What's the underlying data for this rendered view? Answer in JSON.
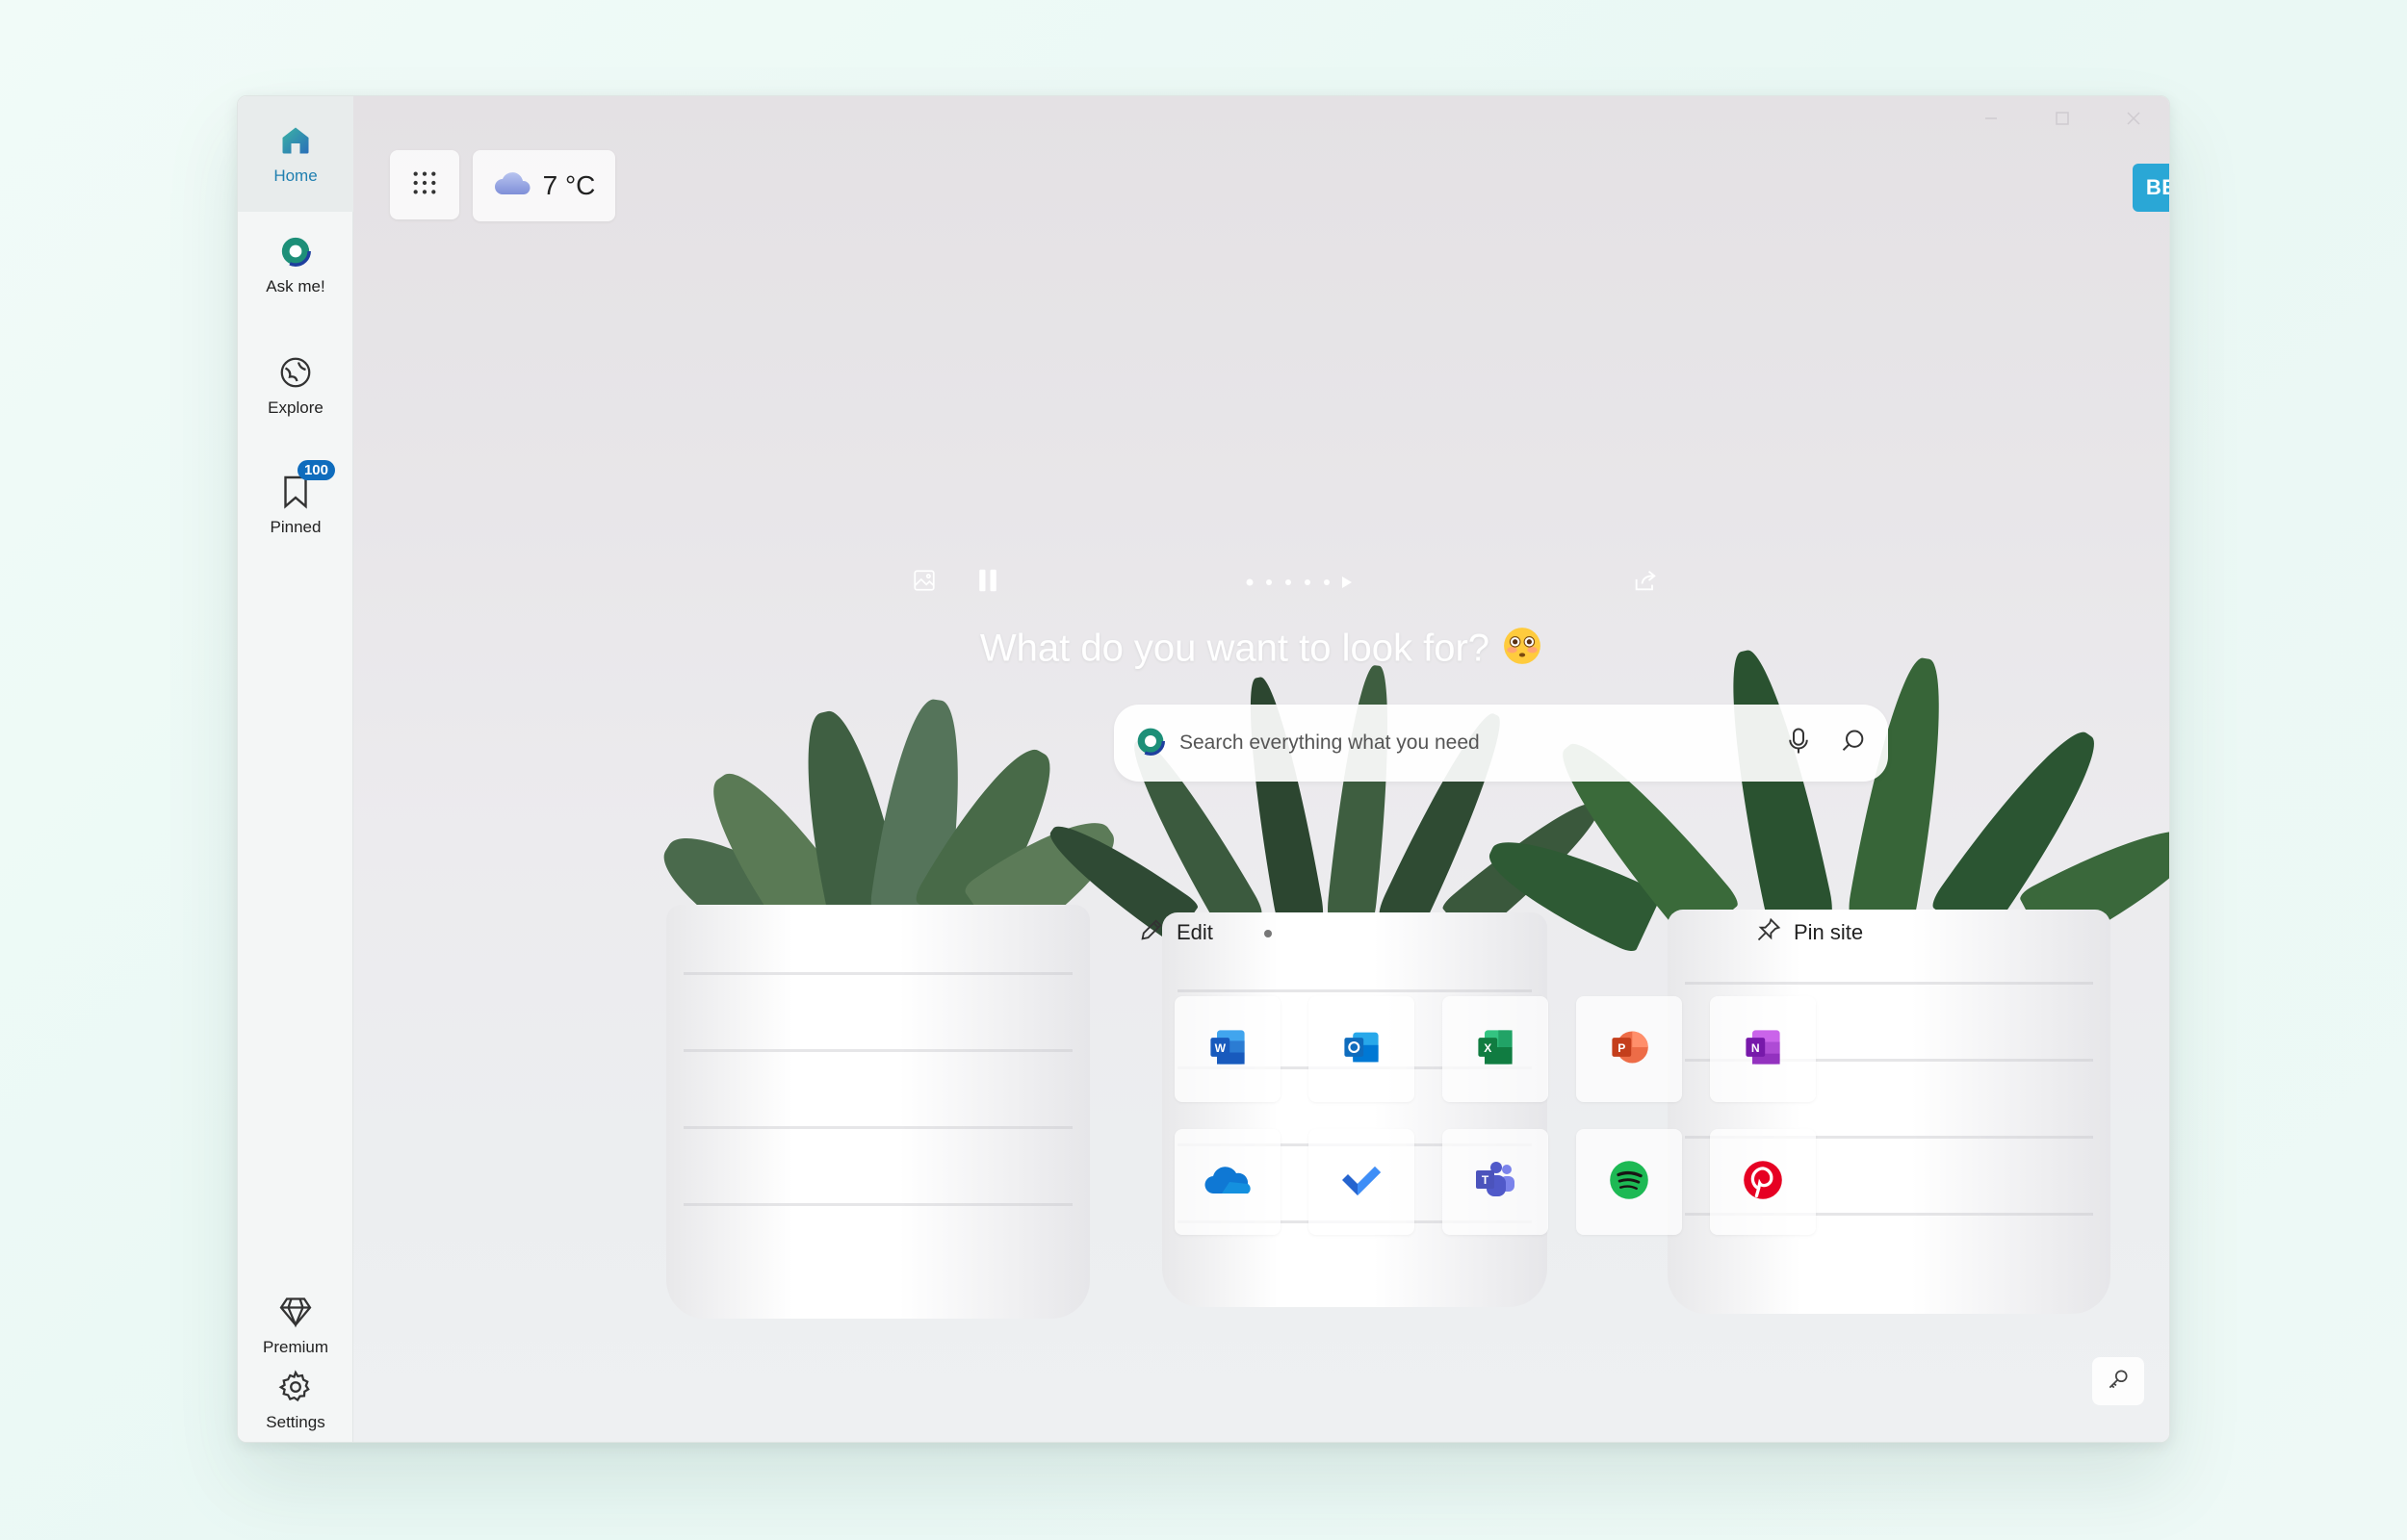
{
  "sidebar": {
    "items": [
      {
        "label": "Home",
        "icon": "home-icon"
      },
      {
        "label": "Ask me!",
        "icon": "ask-me-icon"
      },
      {
        "label": "Explore",
        "icon": "explore-icon"
      },
      {
        "label": "Pinned",
        "icon": "bookmark-icon",
        "badge": "100"
      }
    ],
    "bottom_items": [
      {
        "label": "Premium",
        "icon": "diamond-icon"
      },
      {
        "label": "Settings",
        "icon": "gear-icon"
      }
    ]
  },
  "header": {
    "weather": {
      "temperature": "7 °C",
      "icon": "cloud-icon"
    },
    "beta_label": "BETA"
  },
  "hero": {
    "headline": "What do you want to look for?",
    "emoji": "😳"
  },
  "search": {
    "placeholder": "Search everything what you need"
  },
  "actions": {
    "edit_label": "Edit",
    "pin_label": "Pin site"
  },
  "apps": [
    {
      "name": "Word",
      "icon": "word-icon",
      "color": "#185abd"
    },
    {
      "name": "Outlook",
      "icon": "outlook-icon",
      "color": "#0f6cbd"
    },
    {
      "name": "Excel",
      "icon": "excel-icon",
      "color": "#107c41"
    },
    {
      "name": "PowerPoint",
      "icon": "powerpoint-icon",
      "color": "#c43e1c"
    },
    {
      "name": "OneNote",
      "icon": "onenote-icon",
      "color": "#7719aa"
    },
    {
      "name": "OneDrive",
      "icon": "onedrive-icon",
      "color": "#0f6cbd"
    },
    {
      "name": "To Do",
      "icon": "todo-icon",
      "color": "#2564cf"
    },
    {
      "name": "Teams",
      "icon": "teams-icon",
      "color": "#5b5fc7"
    },
    {
      "name": "Spotify",
      "icon": "spotify-icon",
      "color": "#1db954"
    },
    {
      "name": "Pinterest",
      "icon": "pinterest-icon",
      "color": "#e60023"
    }
  ],
  "colors": {
    "accent": "#2aa7d6",
    "badge": "#0f6cbd",
    "active_nav": "#1f7fb0"
  }
}
